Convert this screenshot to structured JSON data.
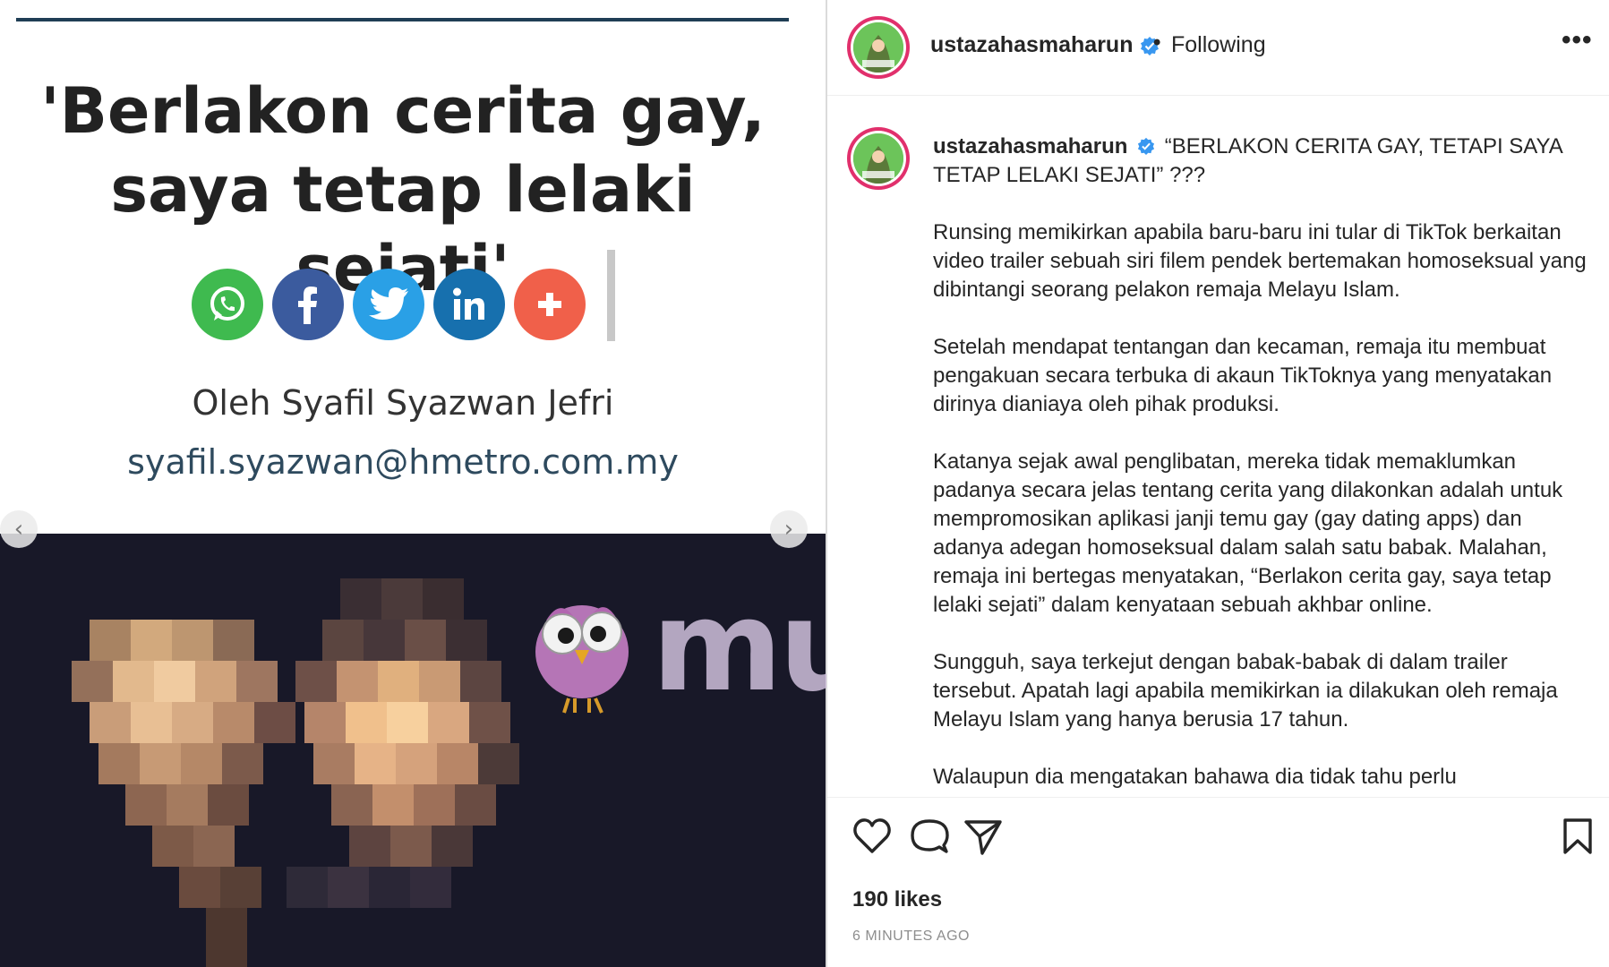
{
  "article": {
    "headline": "'Berlakon cerita gay,\nsaya tetap lelaki sejati'",
    "byline": "Oleh Syafil Syazwan Jefri",
    "email": "syafil.syazwan@hmetro.com.my",
    "share_buttons": [
      {
        "icon": "whatsapp-icon",
        "color": "#3fba4f"
      },
      {
        "icon": "facebook-icon",
        "color": "#3b5b9e"
      },
      {
        "icon": "twitter-icon",
        "color": "#2aa0e6"
      },
      {
        "icon": "linkedin-icon",
        "color": "#1770ae"
      },
      {
        "icon": "plus-icon",
        "color": "#f0604a"
      }
    ]
  },
  "watermark": {
    "text": "murai"
  },
  "post": {
    "username": "ustazahasmaharun",
    "following_label": "Following",
    "more_label": "•••",
    "caption_title": "“BERLAKON CERITA GAY, TETAPI SAYA TETAP LELAKI SEJATI” ???",
    "paragraphs": [
      "Runsing memikirkan apabila baru-baru ini tular di TikTok berkaitan video trailer sebuah siri filem pendek bertemakan homoseksual yang dibintangi seorang pelakon remaja Melayu Islam.",
      "Setelah mendapat tentangan dan kecaman, remaja itu membuat pengakuan secara terbuka di akaun TikToknya yang menyatakan dirinya dianiaya oleh pihak produksi.",
      "Katanya sejak awal penglibatan, mereka tidak memaklumkan padanya secara jelas tentang cerita yang dilakonkan adalah untuk mempromosikan aplikasi janji temu gay (gay dating apps) dan adanya adegan homoseksual dalam salah satu babak. Malahan, remaja ini bertegas menyatakan, “Berlakon cerita gay, saya tetap lelaki sejati” dalam kenyataan sebuah akhbar online.",
      "Sungguh, saya terkejut dengan babak-babak di dalam trailer tersebut. Apatah lagi apabila memikirkan ia dilakukan oleh remaja Melayu Islam yang hanya berusia 17 tahun.",
      "Walaupun dia mengatakan bahawa dia tidak tahu perlu"
    ],
    "likes": "190 likes",
    "time_ago": "6 MINUTES AGO"
  },
  "colors": {
    "verified": "#3897f0",
    "avatar_ring": "#e1306c",
    "text_primary": "#262626",
    "text_secondary": "#8e8e8e"
  }
}
